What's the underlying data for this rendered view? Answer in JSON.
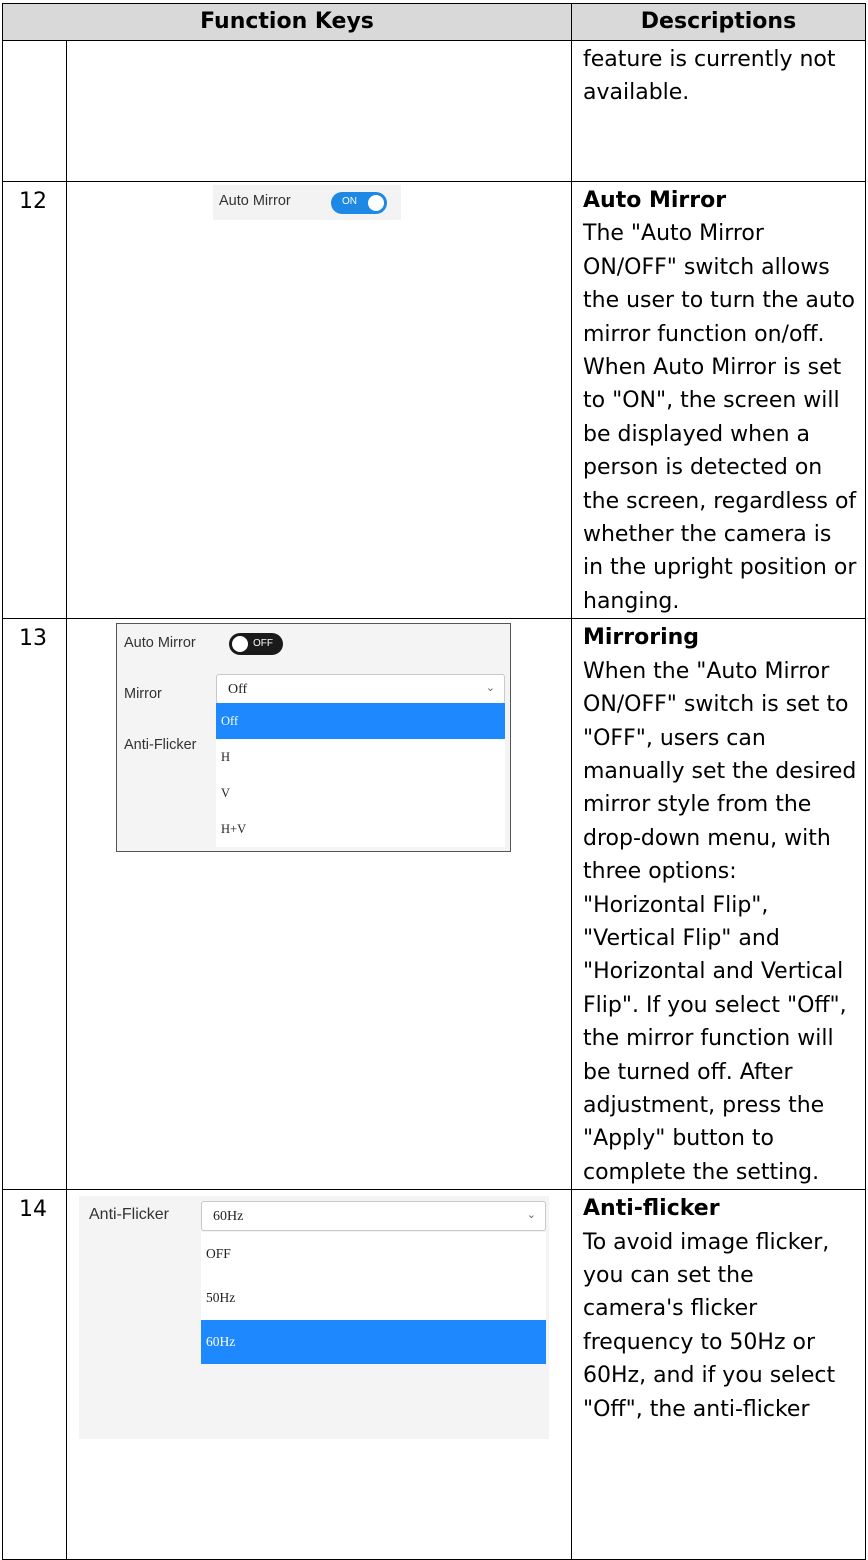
{
  "table": {
    "headers": [
      "Function Keys",
      "Descriptions"
    ],
    "rows": [
      {
        "num": "",
        "title": "",
        "desc": "feature is currently not available."
      },
      {
        "num": "12",
        "title": "Auto Mirror",
        "desc": "The \"Auto Mirror ON/OFF\" switch allows the user to turn the auto mirror function on/off. When Auto Mirror is set to \"ON\", the screen will be displayed when a person is detected on the screen, regardless of whether the camera is in the upright position or hanging."
      },
      {
        "num": "13",
        "title": "Mirroring",
        "desc": "When the \"Auto Mirror ON/OFF\" switch is set to \"OFF\", users can manually set the desired mirror style from the drop-down menu, with three options: \"Horizontal Flip\", \"Vertical Flip\" and \"Horizontal and Vertical Flip\". If you select \"Off\", the mirror function will be turned off. After adjustment, press the \"Apply\" button to complete the setting."
      },
      {
        "num": "14",
        "title": "Anti-flicker",
        "desc": "To avoid image flicker, you can set the camera's flicker frequency to 50Hz or 60Hz, and if you select \"Off\", the anti-flicker"
      }
    ]
  },
  "ui_auto_mirror": {
    "label": "Auto Mirror",
    "toggle": "ON"
  },
  "ui_mirroring": {
    "auto_mirror_label": "Auto Mirror",
    "toggle": "OFF",
    "mirror_label": "Mirror",
    "anti_flicker_label": "Anti-Flicker",
    "selected": "Off",
    "options": [
      "Off",
      "H",
      "V",
      "H+V"
    ]
  },
  "ui_anti_flicker": {
    "label": "Anti-Flicker",
    "selected": "60Hz",
    "options": [
      "OFF",
      "50Hz",
      "60Hz"
    ]
  },
  "colors": {
    "header_bg": "#d9d9d9",
    "accent_blue": "#1e88ff",
    "toggle_off": "#1a1a1a"
  }
}
